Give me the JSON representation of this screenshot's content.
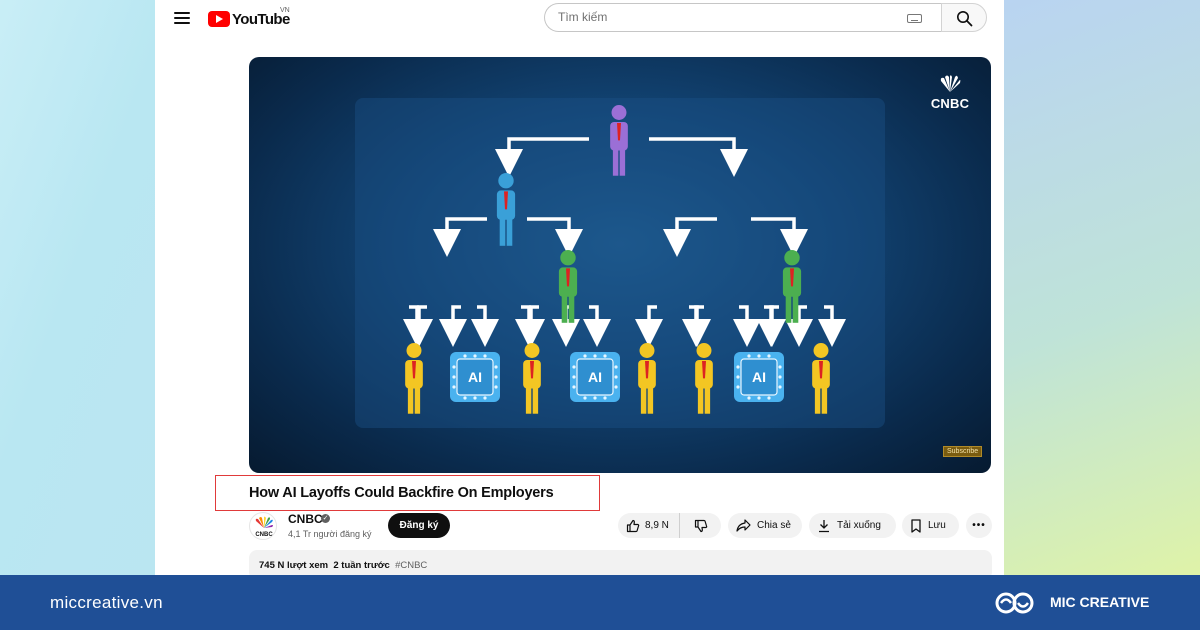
{
  "header": {
    "logo_text": "YouTube",
    "region": "VN",
    "search_placeholder": "Tìm kiếm"
  },
  "video": {
    "channel_watermark": "CNBC",
    "thumbnail_label": "AI",
    "subscribe_tag": "Subscribe"
  },
  "title": "How AI Layoffs Could Backfire On Employers",
  "channel": {
    "name": "CNBC",
    "avatar_text": "CNBC",
    "subscribers": "4,1 Tr người đăng ký",
    "subscribe_label": "Đăng ký"
  },
  "actions": {
    "likes": "8,9 N",
    "share": "Chia sẻ",
    "download": "Tải xuống",
    "save": "Lưu",
    "more": "•••"
  },
  "description": {
    "views": "745 N lượt xem",
    "age": "2 tuần trước",
    "hashtag": "#CNBC"
  },
  "footer": {
    "site": "miccreative.vn",
    "brand": "MIC CREATIVE"
  },
  "colors": {
    "youtube_red": "#ff0000",
    "footer_blue": "#1f4f96",
    "title_highlight": "#e03a3a"
  }
}
